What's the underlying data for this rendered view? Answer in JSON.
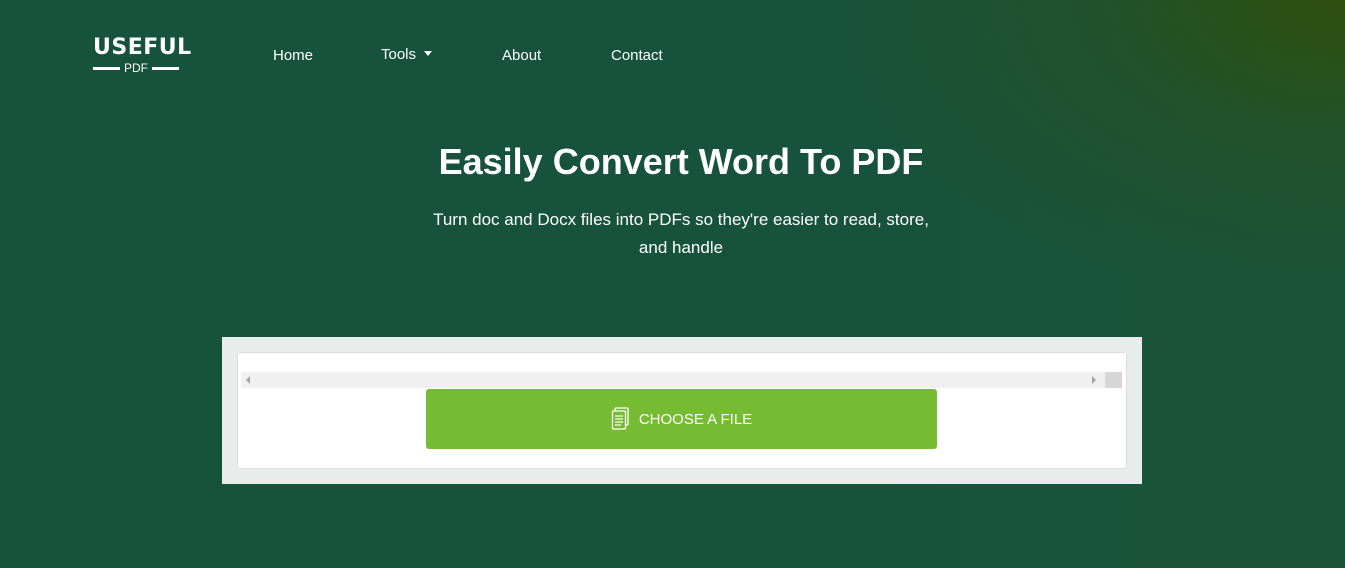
{
  "header": {
    "logo_main": "USEFUL",
    "logo_sub": "PDF",
    "nav": [
      {
        "label": "Home"
      },
      {
        "label": "Tools"
      },
      {
        "label": "About"
      },
      {
        "label": "Contact"
      }
    ]
  },
  "hero": {
    "title": "Easily Convert Word To PDF",
    "subtitle": "Turn doc and Docx files into PDFs so they're easier to read, store, and handle"
  },
  "upload": {
    "button_label": "CHOOSE A FILE",
    "button_icon": "document-icon"
  },
  "colors": {
    "background": "#16523c",
    "button": "#76bc32",
    "panel": "#e8ecea",
    "text": "#ffffff"
  }
}
